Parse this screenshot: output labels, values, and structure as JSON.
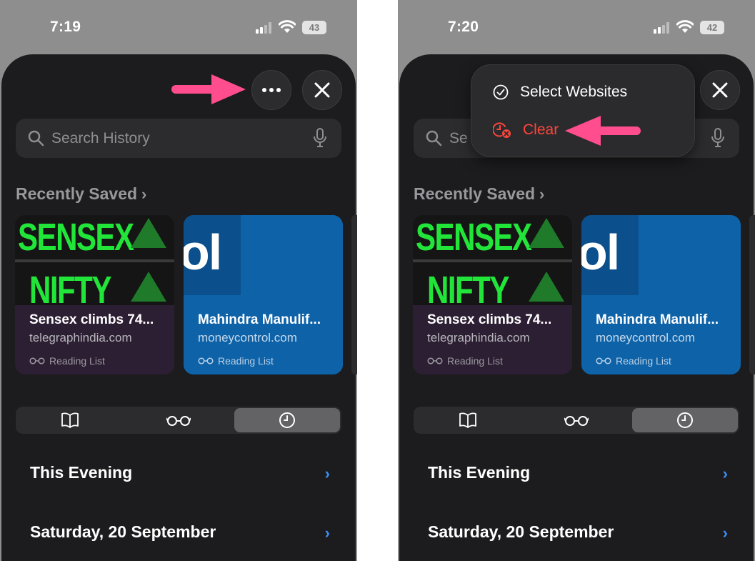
{
  "left_phone": {
    "status": {
      "time": "7:19",
      "battery": "43"
    },
    "search": {
      "placeholder": "Search History"
    },
    "section_title": "Recently Saved",
    "cards": [
      {
        "image_top": "SENSEX",
        "image_bottom": "NIFTY",
        "title": "Sensex climbs 74...",
        "domain": "telegraphindia.com",
        "tag": "Reading List"
      },
      {
        "image_text": "ol",
        "title": "Mahindra Manulif...",
        "domain": "moneycontrol.com",
        "tag": "Reading List"
      }
    ],
    "rows": [
      "This Evening",
      "Saturday, 20 September"
    ]
  },
  "right_phone": {
    "status": {
      "time": "7:20",
      "battery": "42"
    },
    "search": {
      "placeholder": "Se"
    },
    "menu": {
      "select_label": "Select Websites",
      "clear_label": "Clear"
    },
    "section_title": "Recently Saved",
    "cards": [
      {
        "image_top": "SENSEX",
        "image_bottom": "NIFTY",
        "title": "Sensex climbs 74...",
        "domain": "telegraphindia.com",
        "tag": "Reading List"
      },
      {
        "image_text": "ol",
        "title": "Mahindra Manulif...",
        "domain": "moneycontrol.com",
        "tag": "Reading List"
      }
    ],
    "rows": [
      "This Evening",
      "Saturday, 20 September"
    ]
  },
  "colors": {
    "accent_arrow": "#ff4d8d",
    "destructive": "#ff453a",
    "link_blue": "#3a8ef6",
    "sheet": "#1c1c1e"
  },
  "icons": [
    "signal-icon",
    "wifi-icon",
    "more-icon",
    "close-icon",
    "search-icon",
    "mic-icon",
    "book-icon",
    "glasses-icon",
    "clock-icon",
    "checkmark-circle-icon",
    "clear-history-icon"
  ]
}
